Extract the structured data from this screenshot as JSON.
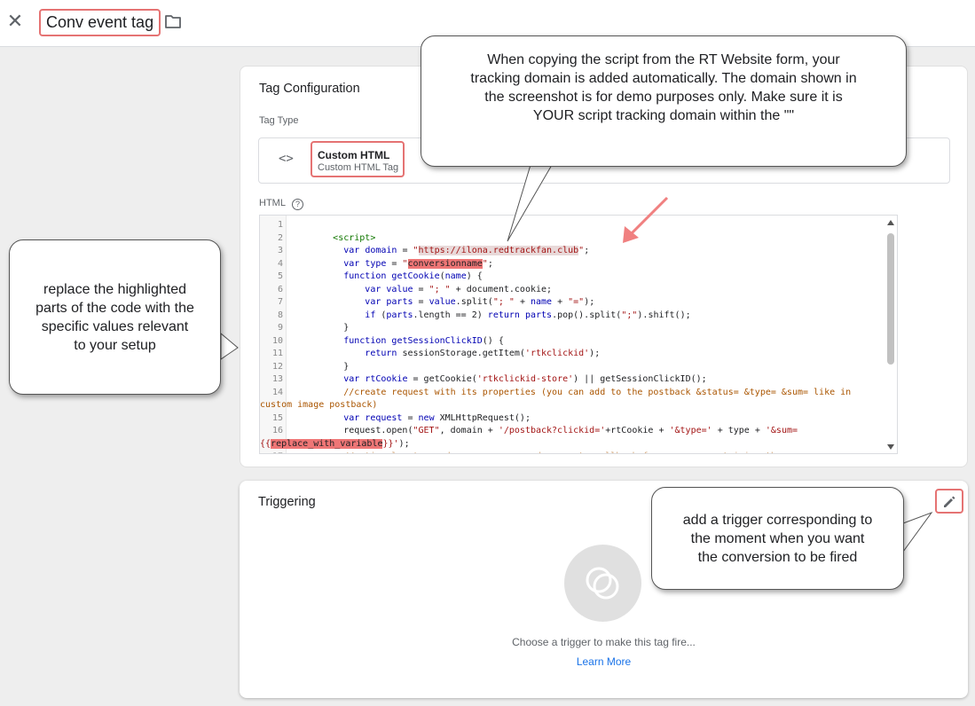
{
  "header": {
    "title": "Conv event tag"
  },
  "tag_config": {
    "title": "Tag Configuration",
    "tag_type_label": "Tag Type",
    "type_name": "Custom HTML",
    "type_subtitle": "Custom HTML Tag",
    "html_label": "HTML",
    "code_lines": [
      {
        "n": "1",
        "t": [
          {
            "c": "",
            "s": ""
          }
        ]
      },
      {
        "n": "2",
        "t": [
          {
            "c": "",
            "s": "        "
          },
          {
            "c": "tagc",
            "s": "<script>"
          }
        ]
      },
      {
        "n": "3",
        "t": [
          {
            "c": "",
            "s": "          "
          },
          {
            "c": "kw",
            "s": "var"
          },
          {
            "c": "",
            "s": " "
          },
          {
            "c": "kw",
            "s": "domain"
          },
          {
            "c": "",
            "s": " = "
          },
          {
            "c": "str",
            "s": "\""
          },
          {
            "c": "str hlg",
            "s": "https://ilona.redtrackfan.club"
          },
          {
            "c": "str",
            "s": "\""
          },
          {
            "c": "",
            "s": ";"
          }
        ]
      },
      {
        "n": "4",
        "t": [
          {
            "c": "",
            "s": "          "
          },
          {
            "c": "kw",
            "s": "var"
          },
          {
            "c": "",
            "s": " "
          },
          {
            "c": "kw",
            "s": "type"
          },
          {
            "c": "",
            "s": " = "
          },
          {
            "c": "str",
            "s": "\""
          },
          {
            "c": "hl",
            "s": "conversionname"
          },
          {
            "c": "str",
            "s": "\""
          },
          {
            "c": "",
            "s": ";"
          }
        ]
      },
      {
        "n": "5",
        "t": [
          {
            "c": "",
            "s": "          "
          },
          {
            "c": "kw",
            "s": "function"
          },
          {
            "c": "",
            "s": " "
          },
          {
            "c": "fn",
            "s": "getCookie"
          },
          {
            "c": "",
            "s": "("
          },
          {
            "c": "kw",
            "s": "name"
          },
          {
            "c": "",
            "s": ") {"
          }
        ]
      },
      {
        "n": "6",
        "t": [
          {
            "c": "",
            "s": "              "
          },
          {
            "c": "kw",
            "s": "var"
          },
          {
            "c": "",
            "s": " "
          },
          {
            "c": "kw",
            "s": "value"
          },
          {
            "c": "",
            "s": " = "
          },
          {
            "c": "str",
            "s": "\"; \""
          },
          {
            "c": "",
            "s": " + document.cookie;"
          }
        ]
      },
      {
        "n": "7",
        "t": [
          {
            "c": "",
            "s": "              "
          },
          {
            "c": "kw",
            "s": "var"
          },
          {
            "c": "",
            "s": " "
          },
          {
            "c": "kw",
            "s": "parts"
          },
          {
            "c": "",
            "s": " = "
          },
          {
            "c": "kw",
            "s": "value"
          },
          {
            "c": "",
            "s": ".split("
          },
          {
            "c": "str",
            "s": "\"; \""
          },
          {
            "c": "",
            "s": " + "
          },
          {
            "c": "kw",
            "s": "name"
          },
          {
            "c": "",
            "s": " + "
          },
          {
            "c": "str",
            "s": "\"=\""
          },
          {
            "c": "",
            "s": ");"
          }
        ]
      },
      {
        "n": "8",
        "t": [
          {
            "c": "",
            "s": "              "
          },
          {
            "c": "kw",
            "s": "if"
          },
          {
            "c": "",
            "s": " ("
          },
          {
            "c": "kw",
            "s": "parts"
          },
          {
            "c": "",
            "s": ".length == 2) "
          },
          {
            "c": "kw",
            "s": "return"
          },
          {
            "c": "",
            "s": " "
          },
          {
            "c": "kw",
            "s": "parts"
          },
          {
            "c": "",
            "s": ".pop().split("
          },
          {
            "c": "str",
            "s": "\";\""
          },
          {
            "c": "",
            "s": ").shift();"
          }
        ]
      },
      {
        "n": "9",
        "t": [
          {
            "c": "",
            "s": "          }"
          }
        ]
      },
      {
        "n": "10",
        "t": [
          {
            "c": "",
            "s": "          "
          },
          {
            "c": "kw",
            "s": "function"
          },
          {
            "c": "",
            "s": " "
          },
          {
            "c": "fn",
            "s": "getSessionClickID"
          },
          {
            "c": "",
            "s": "() {"
          }
        ]
      },
      {
        "n": "11",
        "t": [
          {
            "c": "",
            "s": "              "
          },
          {
            "c": "kw",
            "s": "return"
          },
          {
            "c": "",
            "s": " sessionStorage.getItem("
          },
          {
            "c": "str",
            "s": "'rtkclickid'"
          },
          {
            "c": "",
            "s": ");"
          }
        ]
      },
      {
        "n": "12",
        "t": [
          {
            "c": "",
            "s": "          }"
          }
        ]
      },
      {
        "n": "13",
        "t": [
          {
            "c": "",
            "s": "          "
          },
          {
            "c": "kw",
            "s": "var"
          },
          {
            "c": "",
            "s": " "
          },
          {
            "c": "kw",
            "s": "rtCookie"
          },
          {
            "c": "",
            "s": " = getCookie("
          },
          {
            "c": "str",
            "s": "'rtkclickid-store'"
          },
          {
            "c": "",
            "s": ") || getSessionClickID();"
          }
        ]
      },
      {
        "n": "14",
        "t": [
          {
            "c": "",
            "s": "          "
          },
          {
            "c": "cmt",
            "s": "//create request with its properties (you can add to the postback &status= &type= &sum= like in"
          }
        ]
      },
      {
        "n": "",
        "t": [
          {
            "c": "cmt",
            "s": "custom image postback)"
          }
        ]
      },
      {
        "n": "15",
        "t": [
          {
            "c": "",
            "s": "          "
          },
          {
            "c": "kw",
            "s": "var"
          },
          {
            "c": "",
            "s": " "
          },
          {
            "c": "kw",
            "s": "request"
          },
          {
            "c": "",
            "s": " = "
          },
          {
            "c": "kw",
            "s": "new"
          },
          {
            "c": "",
            "s": " XMLHttpRequest();"
          }
        ]
      },
      {
        "n": "16",
        "t": [
          {
            "c": "",
            "s": "          request.open("
          },
          {
            "c": "str",
            "s": "\"GET\""
          },
          {
            "c": "",
            "s": ", domain + "
          },
          {
            "c": "str",
            "s": "'/postback?clickid='"
          },
          {
            "c": "",
            "s": "+rtCookie + "
          },
          {
            "c": "str",
            "s": "'&type='"
          },
          {
            "c": "",
            "s": " + type + "
          },
          {
            "c": "str",
            "s": "'&sum="
          }
        ]
      },
      {
        "n": "",
        "t": [
          {
            "c": "str",
            "s": "{{"
          },
          {
            "c": "hl",
            "s": "replace_with_variable"
          },
          {
            "c": "str",
            "s": "}}'"
          },
          {
            "c": "",
            "s": ");"
          }
        ]
      },
      {
        "n": "17",
        "t": [
          {
            "c": "",
            "s": "          "
          },
          {
            "c": "cmt",
            "s": "//optional - to read our response code :create callback for success containing the response"
          }
        ]
      }
    ]
  },
  "triggering": {
    "title": "Triggering",
    "hint": "Choose a trigger to make this tag fire...",
    "learn_more": "Learn More"
  },
  "callouts": {
    "top_lines": [
      "When copying the script from the RT Website form, your",
      "tracking domain is added automatically. The domain shown in",
      "the screenshot is for demo purposes only. Make sure it is",
      "YOUR script tracking domain within the \"\""
    ],
    "left_lines": [
      "replace the highlighted",
      "parts of the code with the",
      "specific values relevant",
      "to your setup"
    ],
    "right_lines": [
      "add a trigger corresponding to",
      "the moment when you want",
      "the conversion to be fired"
    ]
  },
  "colors": {
    "highlight_red": "#ef7676",
    "border_red": "#e57373",
    "link_blue": "#1a73e8"
  },
  "icons": [
    "close-icon",
    "folder-icon",
    "code-icon",
    "help-icon",
    "pencil-icon",
    "trigger-empty-icon"
  ]
}
